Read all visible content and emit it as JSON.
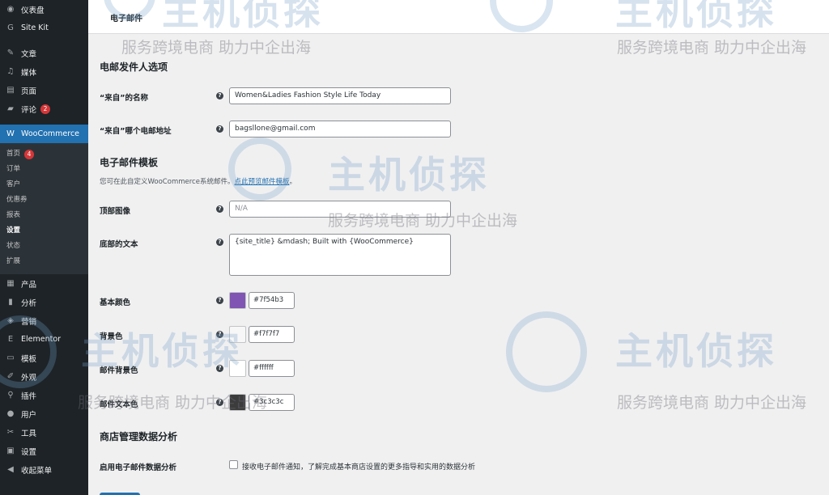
{
  "sidebar": {
    "items_top": [
      {
        "icon": "dashboard-icon",
        "glyph": "◉",
        "label": "仪表盘"
      },
      {
        "icon": "site-kit-icon",
        "glyph": "G",
        "label": "Site Kit"
      }
    ],
    "items_mid": [
      {
        "icon": "pin-icon",
        "glyph": "✎",
        "label": "文章"
      },
      {
        "icon": "media-icon",
        "glyph": "♫",
        "label": "媒体"
      },
      {
        "icon": "page-icon",
        "glyph": "▤",
        "label": "页面"
      },
      {
        "icon": "comment-icon",
        "glyph": "▰",
        "label": "评论",
        "badge": "2"
      }
    ],
    "woocommerce": {
      "icon": "woocommerce-icon",
      "glyph": "W",
      "label": "WooCommerce"
    },
    "woo_sub": [
      {
        "label": "首页",
        "badge": "4"
      },
      {
        "label": "订单"
      },
      {
        "label": "客户"
      },
      {
        "label": "优惠券"
      },
      {
        "label": "报表"
      },
      {
        "label": "设置",
        "current": true
      },
      {
        "label": "状态"
      },
      {
        "label": "扩展"
      }
    ],
    "items_bottom": [
      {
        "icon": "products-icon",
        "glyph": "▦",
        "label": "产品"
      },
      {
        "icon": "analytics-icon",
        "glyph": "▮",
        "label": "分析"
      },
      {
        "icon": "marketing-icon",
        "glyph": "◈",
        "label": "营销"
      },
      {
        "icon": "elementor-icon",
        "glyph": "E",
        "label": "Elementor"
      },
      {
        "icon": "templates-icon",
        "glyph": "▭",
        "label": "模板"
      },
      {
        "icon": "appearance-icon",
        "glyph": "✐",
        "label": "外观"
      },
      {
        "icon": "plugins-icon",
        "glyph": "⚲",
        "label": "插件"
      },
      {
        "icon": "users-icon",
        "glyph": "●",
        "label": "用户"
      },
      {
        "icon": "tools-icon",
        "glyph": "✂",
        "label": "工具"
      },
      {
        "icon": "settings-icon",
        "glyph": "▣",
        "label": "设置"
      },
      {
        "icon": "collapse-icon",
        "glyph": "◀",
        "label": "收起菜单"
      }
    ]
  },
  "topbar": {
    "title": "电子邮件"
  },
  "sender": {
    "section_title": "电邮发件人选项",
    "from_name_label": "“来自”的名称",
    "from_name_value": "Women&Ladies Fashion Style Life Today",
    "from_email_label": "“来自”哪个电邮地址",
    "from_email_value": "bagsllone@gmail.com"
  },
  "template": {
    "section_title": "电子邮件模板",
    "desc_text": "您可在此自定义WooCommerce系统邮件。",
    "desc_link": "点此预览邮件模板",
    "desc_end": "。",
    "header_image_label": "顶部图像",
    "header_image_placeholder": "N/A",
    "footer_text_label": "底部的文本",
    "footer_text_value": "{site_title} &mdash; Built with {WooCommerce}",
    "base_color_label": "基本颜色",
    "base_color_value": "#7f54b3",
    "bg_color_label": "背景色",
    "bg_color_value": "#f7f7f7",
    "body_bg_color_label": "邮件背景色",
    "body_bg_color_value": "#ffffff",
    "body_text_color_label": "邮件文本色",
    "body_text_color_value": "#3c3c3c"
  },
  "analytics": {
    "section_title": "商店管理数据分析",
    "enable_label": "启用电子邮件数据分析",
    "checkbox_text": "接收电子邮件通知，了解完成基本商店设置的更多指导和实用的数据分析"
  },
  "help_glyph": "?",
  "watermark": {
    "big": "主机侦探",
    "small": "服务跨境电商  助力中企出海"
  }
}
